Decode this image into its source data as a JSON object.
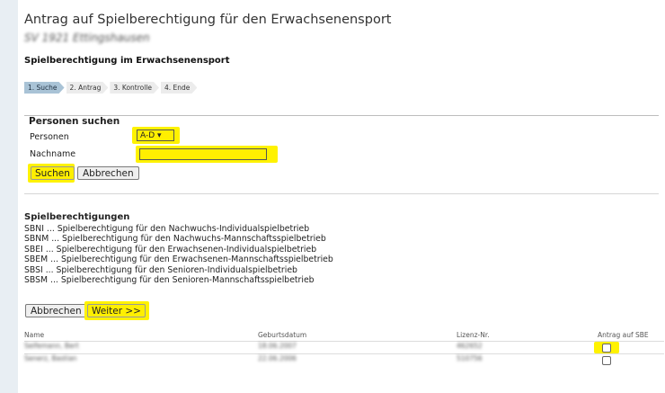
{
  "header": {
    "title": "Antrag auf Spielberechtigung für den Erwachsenensport",
    "club_blurred": "SV 1921 Ettingshausen"
  },
  "section_title": "Spielberechtigung im Erwachsenensport",
  "steps": [
    "1. Suche",
    "2. Antrag",
    "3. Kontrolle",
    "4. Ende"
  ],
  "search": {
    "legend": "Personen suchen",
    "personen_label": "Personen",
    "personen_value": "A-D",
    "nachname_label": "Nachname",
    "nachname_value": "",
    "search_button": "Suchen",
    "cancel_button": "Abbrechen"
  },
  "codes_title": "Spielberechtigungen",
  "codes": [
    "SBNI  ...  Spielberechtigung für den Nachwuchs-Individualspielbetrieb",
    "SBNM  ...  Spielberechtigung für den Nachwuchs-Mannschaftsspielbetrieb",
    "SBEI  ...  Spielberechtigung für den Erwachsenen-Individualspielbetrieb",
    "SBEM  ...  Spielberechtigung für den Erwachsenen-Mannschaftsspielbetrieb",
    "SBSI  ...  Spielberechtigung für den Senioren-Individualspielbetrieb",
    "SBSM  ...  Spielberechtigung für den Senioren-Mannschaftsspielbetrieb"
  ],
  "actions": {
    "cancel": "Abbrechen",
    "next": "Weiter >>"
  },
  "table": {
    "headers": [
      "Name",
      "Geburtsdatum",
      "Lizenz-Nr.",
      "Antrag auf SBE"
    ],
    "rows": [
      {
        "name": "Seifemann, Bert",
        "birth": "18.06.2007",
        "license": "462652"
      },
      {
        "name": "Senerz, Bastian",
        "birth": "22.06.2006",
        "license": "510756"
      }
    ]
  },
  "colors": {
    "highlight": "#fff200",
    "active_step": "#a9c3d6",
    "background": "#e8eef3"
  }
}
